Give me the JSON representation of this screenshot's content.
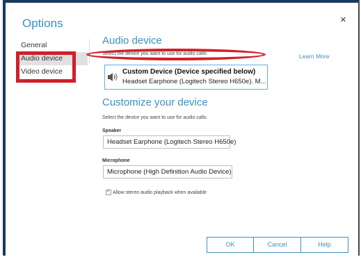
{
  "window": {
    "title": "Options",
    "close_glyph": "×"
  },
  "nav": {
    "items": [
      {
        "label": "General",
        "selected": false
      },
      {
        "label": "Audio device",
        "selected": true
      },
      {
        "label": "Video device",
        "selected": false
      }
    ]
  },
  "audio_section": {
    "heading": "Audio device",
    "hint": "Select the device you want to use for audio calls:",
    "learn_more": "Learn More",
    "device": {
      "name": "Custom Device (Device specified below)",
      "detail": "Headset Earphone (Logitech Stereo H650e). M..."
    }
  },
  "customize_section": {
    "heading": "Customize your device",
    "hint": "Select the device you want to use for audio calls:",
    "speaker_label": "Speaker",
    "speaker_value": "Headset Earphone (Logitech Stereo H650e)",
    "microphone_label": "Microphone",
    "microphone_value": "Microphone (High Definition Audio Device)",
    "stereo_checkbox": {
      "label": "Allow stereo audio playback when available",
      "checked": true
    }
  },
  "buttons": {
    "ok": "OK",
    "cancel": "Cancel",
    "help": "Help"
  },
  "colors": {
    "accent": "#3b8fc1",
    "highlight_red": "#d01f2a",
    "frame": "#1b3a61"
  }
}
